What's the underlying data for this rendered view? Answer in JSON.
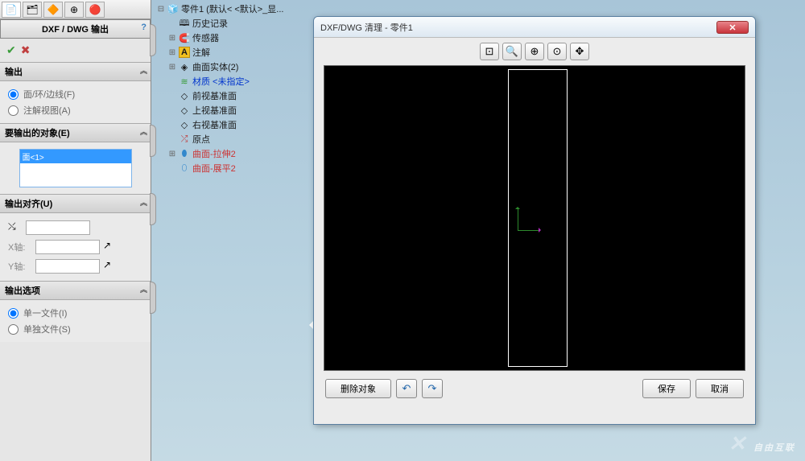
{
  "panel": {
    "title": "DXF / DWG 输出",
    "sections": {
      "output": {
        "label": "输出",
        "radio1": "面/环/边线(F)",
        "radio2": "注解视图(A)"
      },
      "objects": {
        "label": "要输出的对象(E)",
        "selected_item": "面<1>"
      },
      "align": {
        "label": "输出对齐(U)",
        "x_label": "X轴:",
        "y_label": "Y轴:"
      },
      "options": {
        "label": "输出选项",
        "radio1": "单一文件(I)",
        "radio2": "单独文件(S)"
      }
    }
  },
  "tree": {
    "root": "零件1  (默认< <默认>_显...",
    "items": [
      "历史记录",
      "传感器",
      "注解",
      "曲面实体(2)",
      "材质 <未指定>",
      "前视基准面",
      "上视基准面",
      "右视基准面",
      "原点",
      "曲面-拉伸2",
      "曲面-展平2"
    ]
  },
  "dialog": {
    "title": "DXF/DWG 清理 - 零件1",
    "delete_btn": "删除对象",
    "save_btn": "保存",
    "cancel_btn": "取消"
  },
  "watermark": "自由互联"
}
